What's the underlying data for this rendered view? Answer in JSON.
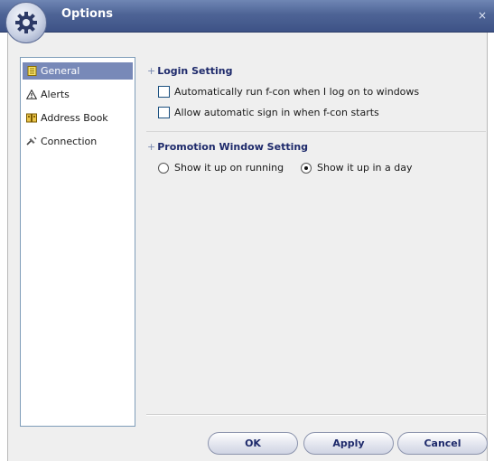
{
  "window": {
    "title": "Options",
    "close_label": "×"
  },
  "sidebar": {
    "items": [
      {
        "label": "General",
        "icon": "page-icon",
        "selected": true
      },
      {
        "label": "Alerts",
        "icon": "warning-icon",
        "selected": false
      },
      {
        "label": "Address Book",
        "icon": "address-book-icon",
        "selected": false
      },
      {
        "label": "Connection",
        "icon": "connection-icon",
        "selected": false
      }
    ]
  },
  "login_section": {
    "title": "Login Setting",
    "options": [
      {
        "label": "Automatically run f-con  when I log on to windows",
        "checked": false
      },
      {
        "label": "Allow automatic sign in when f-con starts",
        "checked": false
      }
    ]
  },
  "promo_section": {
    "title": "Promotion Window Setting",
    "options": [
      {
        "label": "Show it up on running",
        "checked": false
      },
      {
        "label": "Show it up in a day",
        "checked": true
      }
    ]
  },
  "buttons": {
    "ok": "OK",
    "apply": "Apply",
    "cancel": "Cancel"
  },
  "colors": {
    "titlebar": "#4e6496",
    "selection": "#7889b8",
    "heading": "#1e2a6b"
  }
}
